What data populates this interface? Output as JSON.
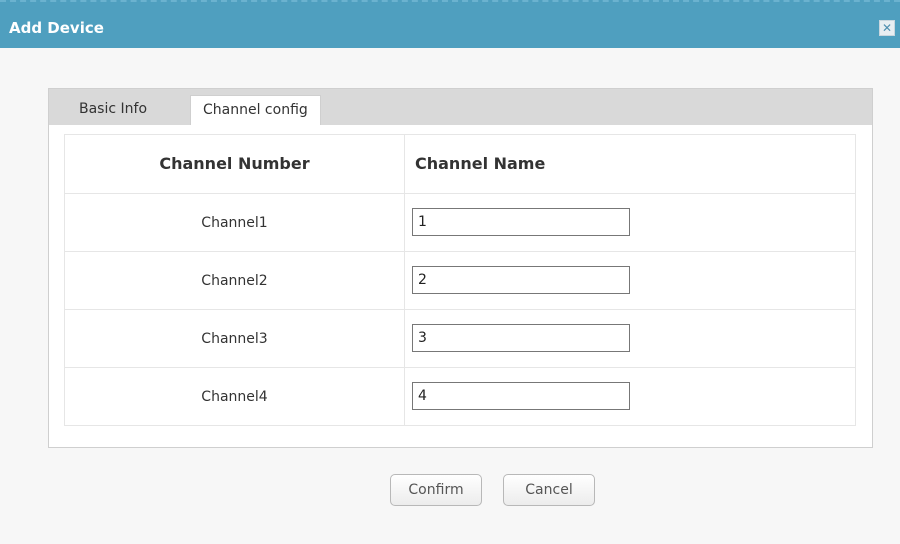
{
  "dialog": {
    "title": "Add Device",
    "close_icon": "close-icon"
  },
  "tabs": [
    {
      "label": "Basic Info",
      "active": false
    },
    {
      "label": "Channel config",
      "active": true
    }
  ],
  "table": {
    "headers": [
      "Channel Number",
      "Channel Name"
    ],
    "rows": [
      {
        "number": "Channel1",
        "name": "1"
      },
      {
        "number": "Channel2",
        "name": "2"
      },
      {
        "number": "Channel3",
        "name": "3"
      },
      {
        "number": "Channel4",
        "name": "4"
      }
    ]
  },
  "buttons": {
    "confirm": "Confirm",
    "cancel": "Cancel"
  },
  "colors": {
    "titlebar": "#4f9fbf",
    "tabbar": "#d9d9d9"
  }
}
